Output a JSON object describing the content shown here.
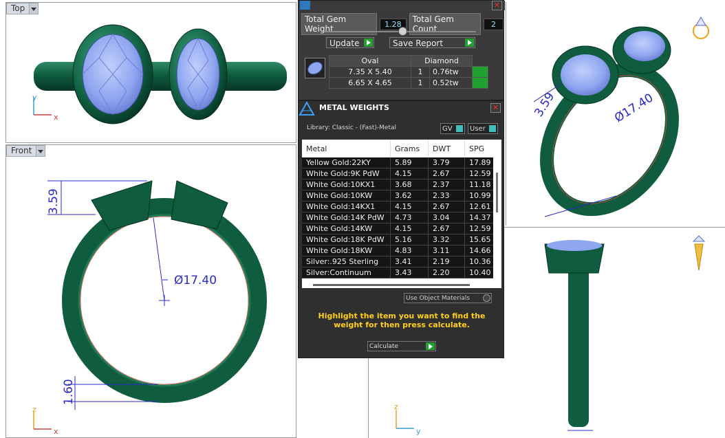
{
  "viewports": {
    "top": {
      "label": "Top",
      "axis_y": "y",
      "axis_x": "x"
    },
    "front": {
      "label": "Front",
      "axis_z": "z",
      "axis_x": "x",
      "dim_height": "3.59",
      "dim_diameter": "Ø17.40",
      "dim_band": "1.60"
    },
    "perspective": {
      "dim_small": "3.59",
      "dim_diameter": "Ø17.40"
    },
    "right": {
      "axis_z": "z",
      "axis_y": "y"
    }
  },
  "gem_panel": {
    "total_weight_label": "Total Gem Weight",
    "total_weight_value": "1.28",
    "total_count_label": "Total Gem Count",
    "total_count_value": "2",
    "update_button": "Update",
    "save_report_button": "Save Report",
    "table": {
      "headers": [
        "Oval",
        "Diamond"
      ],
      "rows": [
        {
          "size": "7.35 X 5.40",
          "count": "1",
          "weight": "0.76tw"
        },
        {
          "size": "6.65 X 4.65",
          "count": "1",
          "weight": "0.52tw"
        }
      ]
    }
  },
  "metal_panel": {
    "title": "METAL WEIGHTS",
    "library": "Library: Classic - (Fast)-Metal",
    "gv_toggle": "GV",
    "user_toggle": "User",
    "columns": [
      "Metal",
      "Grams",
      "DWT",
      "SPG"
    ],
    "rows": [
      [
        "Yellow Gold:22KY",
        "5.89",
        "3.79",
        "17.89"
      ],
      [
        "White Gold:9K PdW",
        "4.15",
        "2.67",
        "12.59"
      ],
      [
        "White Gold:10KX1",
        "3.68",
        "2.37",
        "11.18"
      ],
      [
        "White Gold:10KW",
        "3.62",
        "2.33",
        "10.99"
      ],
      [
        "White Gold:14KX1",
        "4.15",
        "2.67",
        "12.61"
      ],
      [
        "White Gold:14K PdW",
        "4.73",
        "3.04",
        "14.37"
      ],
      [
        "White Gold:14KW",
        "4.15",
        "2.67",
        "12.59"
      ],
      [
        "White Gold:18K PdW",
        "5.16",
        "3.32",
        "15.65"
      ],
      [
        "White Gold:18KW",
        "4.83",
        "3.11",
        "14.66"
      ],
      [
        "Silver:.925 Sterling",
        "3.41",
        "2.19",
        "10.36"
      ],
      [
        "Silver:Continuum",
        "3.43",
        "2.20",
        "10.40"
      ]
    ],
    "use_object_materials": "Use Object Materials",
    "hint": "Highlight the item you want to find the weight for then press calculate.",
    "calculate_button": "Calculate"
  },
  "colors": {
    "metal": "#0f5c3f",
    "gem": "#8fa6f0",
    "dimension": "#2a2ac8",
    "hint": "#ffcf1a"
  }
}
